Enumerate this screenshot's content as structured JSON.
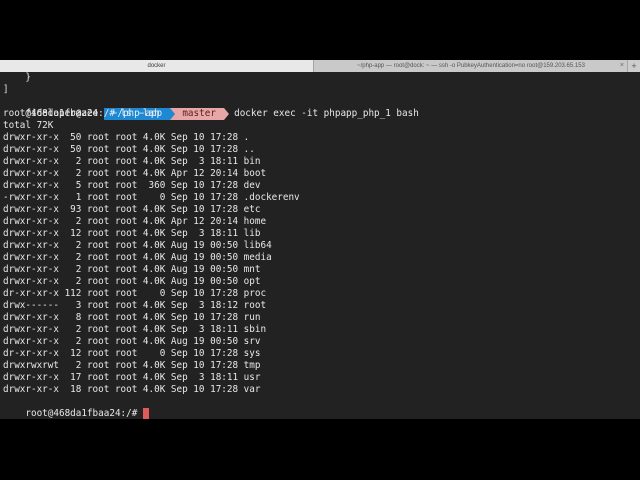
{
  "tabs": [
    {
      "label": "docker"
    },
    {
      "label": "~/php-app — root@dock: ~ — ssh -o PubkeyAuthentication=no root@159.203.65.153"
    }
  ],
  "new_tab": "+",
  "tab_close": "×",
  "colors": {
    "path_segment": "#1e88d2",
    "git_segment": "#e7a7a7",
    "cursor": "#e05a5a",
    "background": "#222222"
  },
  "pre_lines": [
    "    }",
    "]"
  ],
  "prompt": {
    "user": "fideloper@zee",
    "path": " ~/php-app ",
    "branch": " master ",
    "command": " docker exec -it phpapp_php_1 bash"
  },
  "ls_command": "root@468da1fbaa24:/# ls -lah",
  "total": "total 72K",
  "listing": [
    "drwxr-xr-x  50 root root 4.0K Sep 10 17:28 .",
    "drwxr-xr-x  50 root root 4.0K Sep 10 17:28 ..",
    "drwxr-xr-x   2 root root 4.0K Sep  3 18:11 bin",
    "drwxr-xr-x   2 root root 4.0K Apr 12 20:14 boot",
    "drwxr-xr-x   5 root root  360 Sep 10 17:28 dev",
    "-rwxr-xr-x   1 root root    0 Sep 10 17:28 .dockerenv",
    "drwxr-xr-x  93 root root 4.0K Sep 10 17:28 etc",
    "drwxr-xr-x   2 root root 4.0K Apr 12 20:14 home",
    "drwxr-xr-x  12 root root 4.0K Sep  3 18:11 lib",
    "drwxr-xr-x   2 root root 4.0K Aug 19 00:50 lib64",
    "drwxr-xr-x   2 root root 4.0K Aug 19 00:50 media",
    "drwxr-xr-x   2 root root 4.0K Aug 19 00:50 mnt",
    "drwxr-xr-x   2 root root 4.0K Aug 19 00:50 opt",
    "dr-xr-xr-x 112 root root    0 Sep 10 17:28 proc",
    "drwx------   3 root root 4.0K Sep  3 18:12 root",
    "drwxr-xr-x   8 root root 4.0K Sep 10 17:28 run",
    "drwxr-xr-x   2 root root 4.0K Sep  3 18:11 sbin",
    "drwxr-xr-x   2 root root 4.0K Aug 19 00:50 srv",
    "dr-xr-xr-x  12 root root    0 Sep 10 17:28 sys",
    "drwxrwxrwt   2 root root 4.0K Sep 10 17:28 tmp",
    "drwxr-xr-x  17 root root 4.0K Sep  3 18:11 usr",
    "drwxr-xr-x  18 root root 4.0K Sep 10 17:28 var"
  ],
  "final_prompt": "root@468da1fbaa24:/# "
}
